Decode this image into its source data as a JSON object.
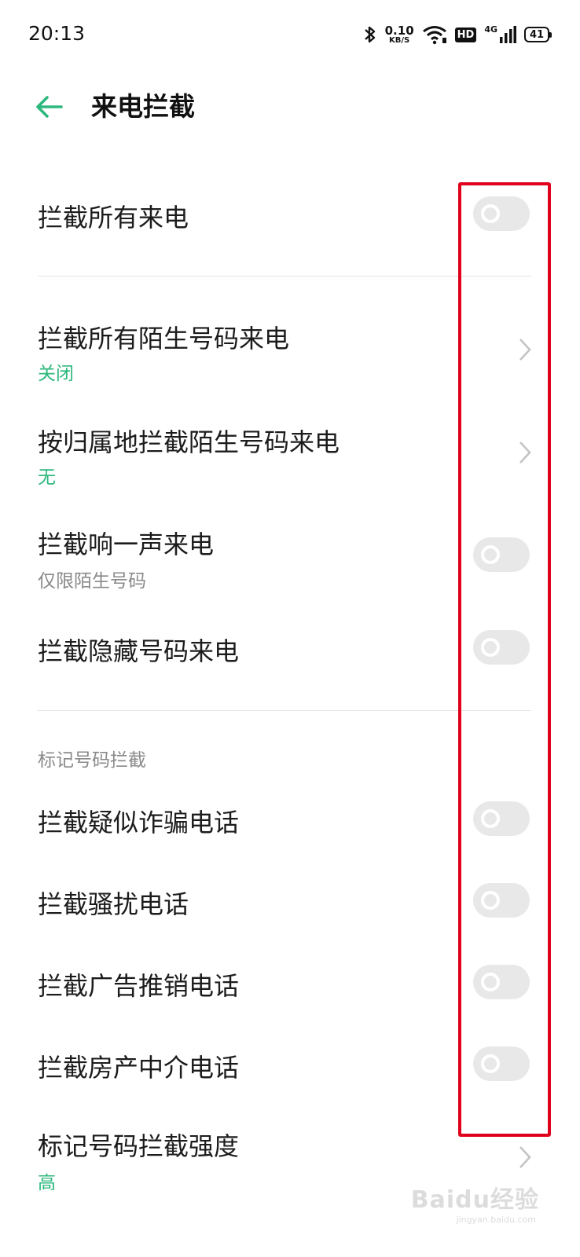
{
  "status_bar": {
    "time": "20:13",
    "speed_value": "0.10",
    "speed_unit": "KB/S",
    "hd": "HD",
    "network": "4G",
    "battery": "41"
  },
  "header": {
    "title": "来电拦截"
  },
  "rows": {
    "block_all": {
      "title": "拦截所有来电",
      "toggle_on": false
    },
    "block_strangers": {
      "title": "拦截所有陌生号码来电",
      "subtitle": "关闭"
    },
    "block_by_region": {
      "title": "按归属地拦截陌生号码来电",
      "subtitle": "无"
    },
    "block_one_ring": {
      "title": "拦截响一声来电",
      "subtitle": "仅限陌生号码",
      "toggle_on": false
    },
    "block_hidden": {
      "title": "拦截隐藏号码来电",
      "toggle_on": false
    }
  },
  "marked_section": {
    "header": "标记号码拦截",
    "fraud": {
      "title": "拦截疑似诈骗电话",
      "toggle_on": false
    },
    "harassment": {
      "title": "拦截骚扰电话",
      "toggle_on": false
    },
    "ads": {
      "title": "拦截广告推销电话",
      "toggle_on": false
    },
    "real_estate": {
      "title": "拦截房产中介电话",
      "toggle_on": false
    },
    "intensity": {
      "title": "标记号码拦截强度",
      "subtitle": "高"
    }
  },
  "colors": {
    "accent": "#2db87d",
    "toggle_off": "#e8e8e8",
    "highlight": "#e0001b"
  },
  "watermark": {
    "text": "Baidu经验",
    "url": "jingyan.baidu.com"
  }
}
